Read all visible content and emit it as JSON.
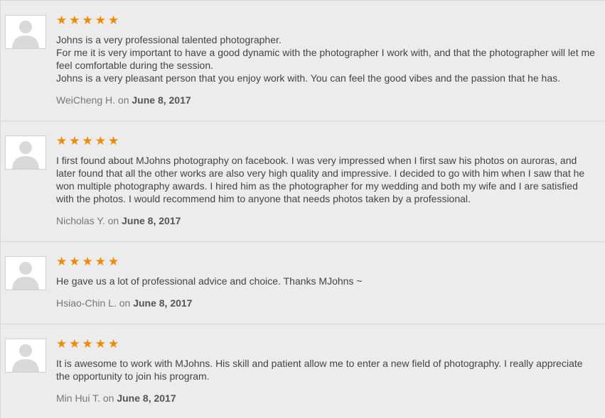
{
  "star_color": "#f08a00",
  "reviews": [
    {
      "stars": "★★★★★",
      "text": "Johns is a very professional talented photographer.\nFor me it is very important to have a good dynamic with the photographer I work with, and that the photographer will let me feel comfortable during the session.\nJohns is a very pleasant person that you enjoy work with. You can feel the good vibes and the passion that he has.",
      "author": "WeiCheng H.",
      "on": "on",
      "date": "June 8, 2017"
    },
    {
      "stars": "★★★★★",
      "text": "I first found about MJohns photography on facebook. I was very impressed when I first saw his photos on auroras, and later found that all the other works are also very high quality and impressive. I decided to go with him when I saw that he won multiple photography awards. I hired him as the photographer for my wedding and both my wife and I are satisfied with the photos. I would recommend him to anyone that needs photos taken by a professional.",
      "author": "Nicholas Y.",
      "on": "on",
      "date": "June 8, 2017"
    },
    {
      "stars": "★★★★★",
      "text": "He gave us a lot of professional advice and choice. Thanks MJohns ~",
      "author": "Hsiao-Chin L.",
      "on": "on",
      "date": "June 8, 2017"
    },
    {
      "stars": "★★★★★",
      "text": "It is awesome to work with MJohns. His skill and patient allow me to enter a new field of photography. I really appreciate the opportunity to join his program.",
      "author": "Min Hui T.",
      "on": "on",
      "date": "June 8, 2017"
    }
  ]
}
